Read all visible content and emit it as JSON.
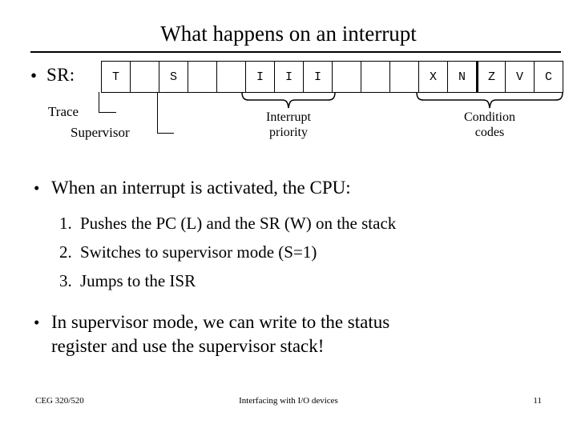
{
  "slide": {
    "title": "What happens on an interrupt",
    "bullet_glyph": "•"
  },
  "status_register": {
    "label": "SR:",
    "cells": [
      "T",
      "",
      "S",
      "",
      "",
      "I",
      "I",
      "I",
      "",
      "",
      "",
      "X",
      "N",
      "Z",
      "V",
      "C"
    ],
    "annotations": {
      "trace": "Trace",
      "supervisor": "Supervisor",
      "interrupt_priority_line1": "Interrupt",
      "interrupt_priority_line2": "priority",
      "condition_codes_line1": "Condition",
      "condition_codes_line2": "codes"
    }
  },
  "body": {
    "bullet_cpu": "When an interrupt is activated, the CPU:",
    "steps": [
      {
        "number": "1.",
        "text": "Pushes the PC (L) and the SR (W) on the stack"
      },
      {
        "number": "2.",
        "text": "Switches to supervisor mode (S=1)"
      },
      {
        "number": "3.",
        "text": "Jumps to the ISR"
      }
    ],
    "bullet_supervisor_line1": "In supervisor mode, we can write to the status",
    "bullet_supervisor_line2": "register and use the supervisor stack!"
  },
  "footer": {
    "left": "CEG 320/520",
    "center": "Interfacing with I/O devices",
    "right": "11"
  },
  "colors": {
    "ink": "#000000",
    "background": "#ffffff"
  }
}
